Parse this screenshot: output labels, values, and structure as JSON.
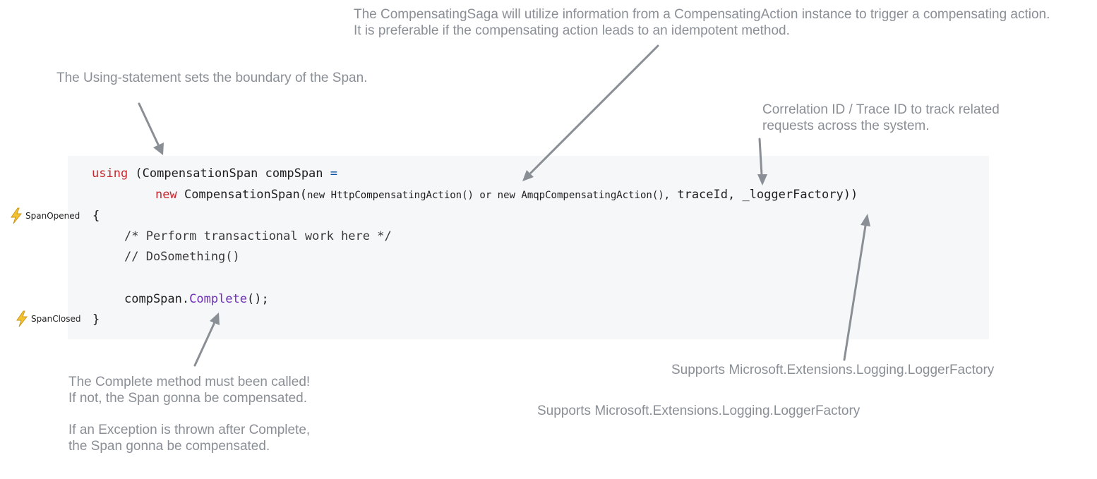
{
  "notes": {
    "saga_line1": "The CompensatingSaga will utilize information from a CompensatingAction instance to trigger a compensating action.",
    "saga_line2": "It is preferable if the compensating action leads to an idempotent method.",
    "using_statement": "The Using-statement sets the boundary of the Span.",
    "trace_line1": "Correlation ID / Trace ID to track related",
    "trace_line2": "requests across the system.",
    "logger_upper": "Supports Microsoft.Extensions.Logging.LoggerFactory",
    "logger_lower": "Supports Microsoft.Extensions.Logging.LoggerFactory",
    "complete_line1": "The Complete method must been called!",
    "complete_line2": "If not, the Span gonna be compensated.",
    "complete_line3": "If an Exception is thrown after Complete,",
    "complete_line4": "the Span gonna be compensated."
  },
  "markers": {
    "opened_icon": "lightning-bolt-icon",
    "opened_label": "SpanOpened",
    "closed_icon": "lightning-bolt-icon",
    "closed_label": "SpanClosed",
    "icon_color": "#f4c430"
  },
  "code": {
    "line1": {
      "keyword": "using",
      "rest": " (CompensationSpan compSpan ",
      "operator": "="
    },
    "line2": {
      "keyword": "new",
      "type_call": " CompensationSpan(",
      "args_small": "new HttpCompensatingAction() or new AmqpCompensatingAction(),",
      "args_rest": " traceId, _loggerFactory))"
    },
    "line3": "{",
    "line4": "/* Perform transactional work here */",
    "line5": "// DoSomething()",
    "line6": {
      "object": "compSpan.",
      "method": "Complete",
      "tail": "();"
    },
    "line7": "}"
  },
  "colors": {
    "annotation_text": "#8a8f96",
    "arrow": "#8a8f96",
    "code_background": "#f6f7f8",
    "keyword": "#c6282e",
    "operator": "#0b4ea2",
    "method": "#6d2fb8"
  }
}
